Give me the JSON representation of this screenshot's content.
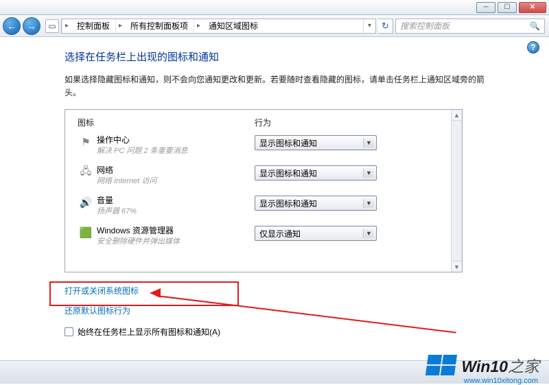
{
  "breadcrumb": {
    "items": [
      "控制面板",
      "所有控制面板项",
      "通知区域图标"
    ]
  },
  "search": {
    "placeholder": "搜索控制面板"
  },
  "page": {
    "title": "选择在任务栏上出现的图标和通知",
    "desc": "如果选择隐藏图标和通知，则不会向您通知更改和更新。若要随时查看隐藏的图标，请单击任务栏上通知区域旁的箭头。"
  },
  "panel": {
    "col_icon": "图标",
    "col_action": "行为",
    "rows": [
      {
        "icon": "flag-icon",
        "glyph": "⚑",
        "title": "操作中心",
        "sub": "解决 PC 问题  2 条重要消息",
        "value": "显示图标和通知"
      },
      {
        "icon": "network-icon",
        "glyph": "🖧",
        "title": "网络",
        "sub": "网络 Internet 访问",
        "value": "显示图标和通知"
      },
      {
        "icon": "volume-icon",
        "glyph": "🔊",
        "title": "音量",
        "sub": "扬声器 67%",
        "value": "显示图标和通知"
      },
      {
        "icon": "explorer-icon",
        "glyph": "🟩",
        "title": "Windows 资源管理器",
        "sub": "安全删除硬件并弹出媒体",
        "value": "仅显示通知"
      }
    ]
  },
  "links": {
    "toggle_system_icons": "打开或关闭系统图标",
    "restore_defaults": "还原默认图标行为"
  },
  "checkbox": {
    "label": "始终在任务栏上显示所有图标和通知(A)"
  },
  "watermark": {
    "big": "Win10",
    "suffix": "之家",
    "url": "www.win10xitong.com"
  }
}
